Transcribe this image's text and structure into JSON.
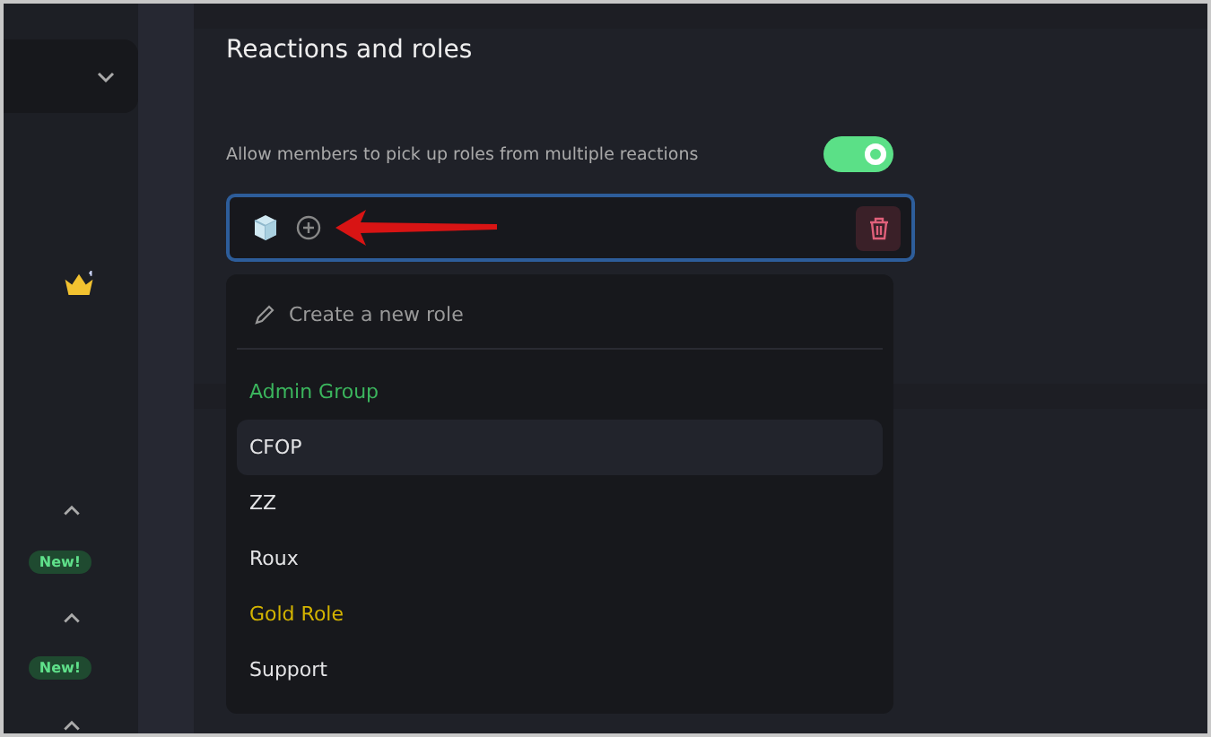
{
  "sidebar": {
    "badges": [
      "New!",
      "New!"
    ]
  },
  "section": {
    "title": "Reactions and roles",
    "toggle": {
      "label": "Allow members to pick up roles from multiple reactions",
      "on": true
    }
  },
  "dropdown": {
    "create_label": "Create a new role",
    "roles": [
      {
        "name": "Admin Group",
        "color": "#3bb55d",
        "selected": false
      },
      {
        "name": "CFOP",
        "color": "#e4e4e6",
        "selected": true
      },
      {
        "name": "ZZ",
        "color": "#e4e4e6",
        "selected": false
      },
      {
        "name": "Roux",
        "color": "#e4e4e6",
        "selected": false
      },
      {
        "name": "Gold Role",
        "color": "#d4b400",
        "selected": false
      },
      {
        "name": "Support",
        "color": "#e4e4e6",
        "selected": false
      }
    ]
  }
}
